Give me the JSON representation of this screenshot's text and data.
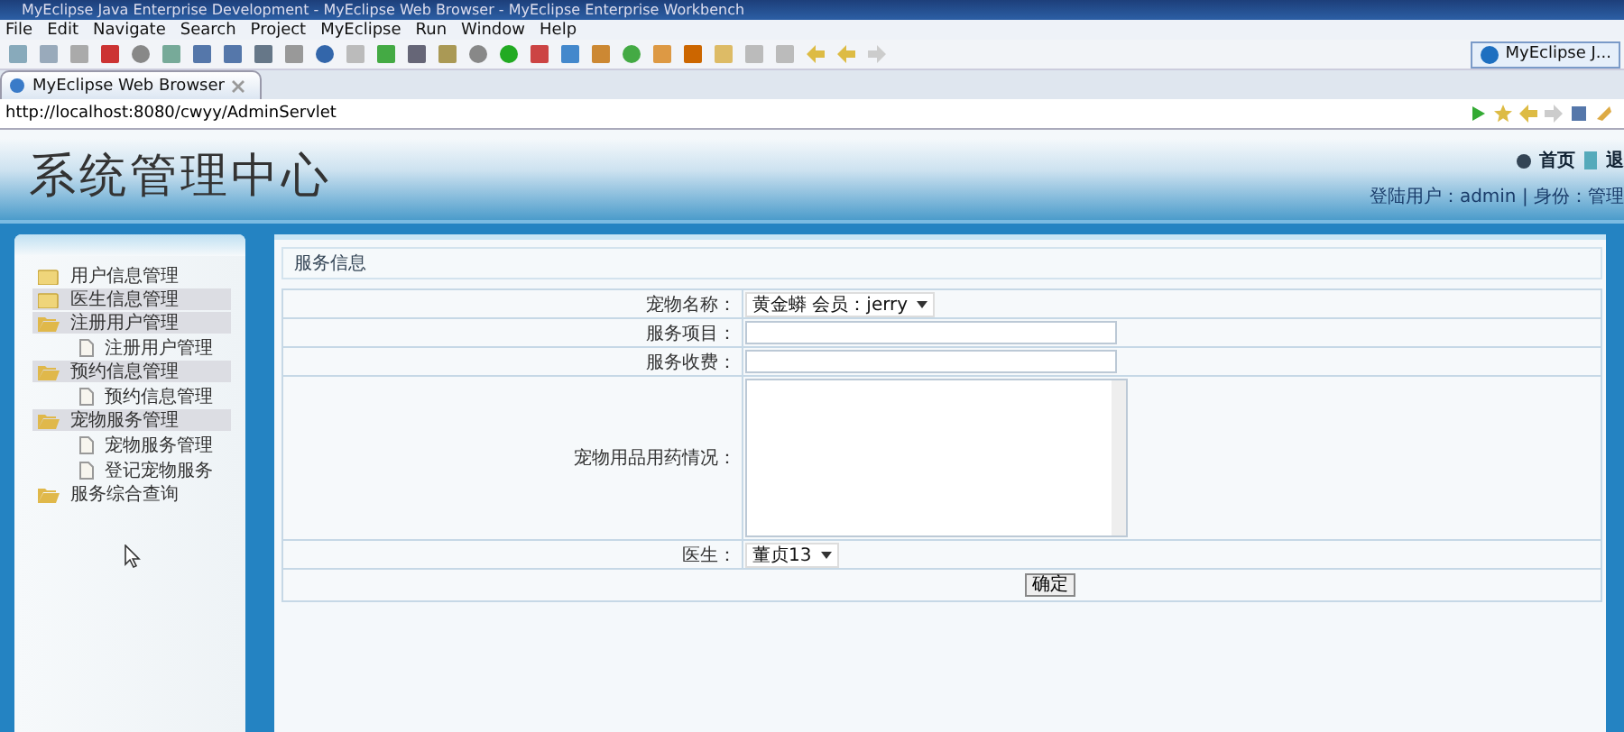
{
  "window": {
    "title": "MyEclipse Java Enterprise Development - MyEclipse Web Browser - MyEclipse Enterprise Workbench"
  },
  "menu": [
    "File",
    "Edit",
    "Navigate",
    "Search",
    "Project",
    "MyEclipse",
    "Run",
    "Window",
    "Help"
  ],
  "perspective": {
    "label": "MyEclipse J..."
  },
  "editor_tab": {
    "title": "MyEclipse Web Browser"
  },
  "address": {
    "value": "http://localhost:8080/cwyy/AdminServlet"
  },
  "header": {
    "title": "系统管理中心",
    "links": [
      "首页",
      "退"
    ],
    "user_info": "登陆用户：admin | 身份：管理"
  },
  "sidebar": {
    "items": [
      {
        "label": "用户信息管理",
        "expanded": false,
        "highlighted": false
      },
      {
        "label": "医生信息管理",
        "expanded": false,
        "highlighted": true
      },
      {
        "label": "注册用户管理",
        "expanded": true,
        "highlighted": true,
        "children": [
          {
            "label": "注册用户管理"
          }
        ]
      },
      {
        "label": "预约信息管理",
        "expanded": true,
        "highlighted": true,
        "children": [
          {
            "label": "预约信息管理"
          }
        ]
      },
      {
        "label": "宠物服务管理",
        "expanded": true,
        "highlighted": true,
        "children": [
          {
            "label": "宠物服务管理"
          },
          {
            "label": "登记宠物服务"
          }
        ]
      },
      {
        "label": "服务综合查询",
        "expanded": true,
        "highlighted": false
      }
    ]
  },
  "panel": {
    "title": "服务信息"
  },
  "form": {
    "fields": [
      {
        "label": "宠物名称：",
        "kind": "select",
        "value": "黄金蟒 会员：jerry"
      },
      {
        "label": "服务项目：",
        "kind": "input"
      },
      {
        "label": "服务收费：",
        "kind": "input"
      },
      {
        "label": "宠物用品用药情况：",
        "kind": "textarea"
      },
      {
        "label": "医生：",
        "kind": "select",
        "value": "董贞13"
      }
    ],
    "submit": "确定"
  }
}
